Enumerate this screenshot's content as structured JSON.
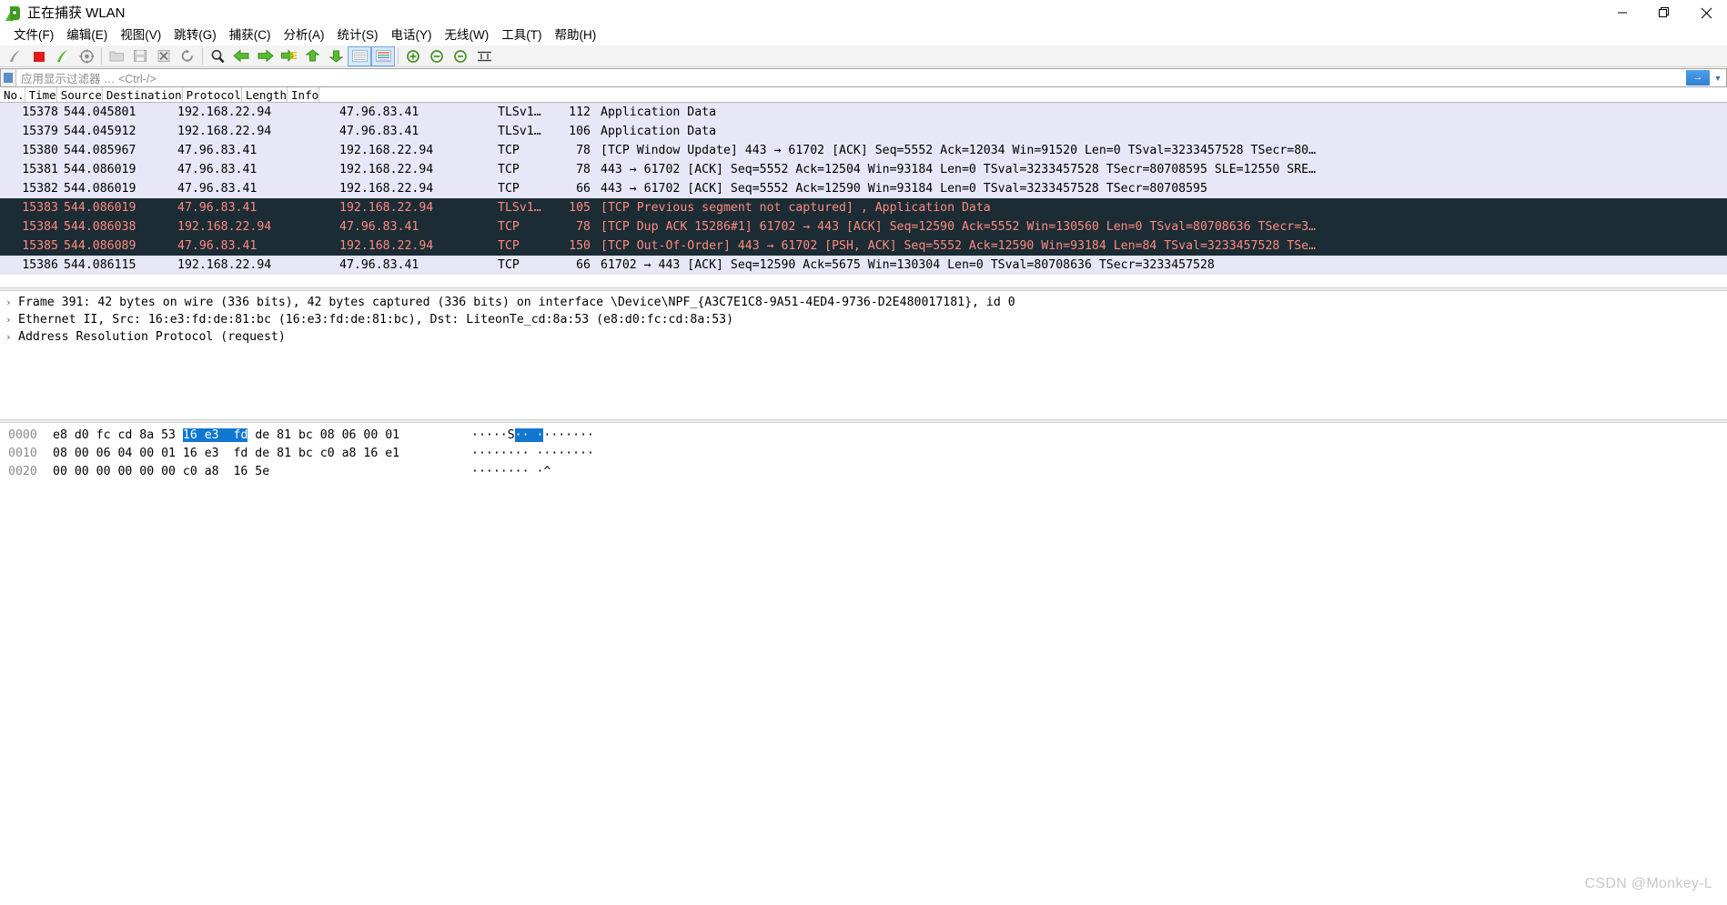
{
  "window": {
    "title": "正在捕获 WLAN",
    "icon": "wireshark-shark-fin-icon",
    "minimize_label": "—",
    "maximize_label": "❐",
    "close_label": "✕"
  },
  "menubar": {
    "items": [
      {
        "label": "文件(F)",
        "name": "menu-file"
      },
      {
        "label": "编辑(E)",
        "name": "menu-edit"
      },
      {
        "label": "视图(V)",
        "name": "menu-view"
      },
      {
        "label": "跳转(G)",
        "name": "menu-go"
      },
      {
        "label": "捕获(C)",
        "name": "menu-capture"
      },
      {
        "label": "分析(A)",
        "name": "menu-analyze"
      },
      {
        "label": "统计(S)",
        "name": "menu-statistics"
      },
      {
        "label": "电话(Y)",
        "name": "menu-telephony"
      },
      {
        "label": "无线(W)",
        "name": "menu-wireless"
      },
      {
        "label": "工具(T)",
        "name": "menu-tools"
      },
      {
        "label": "帮助(H)",
        "name": "menu-help"
      }
    ]
  },
  "toolbar": {
    "buttons": [
      {
        "name": "start-capture-icon",
        "title": "开始捕获"
      },
      {
        "name": "stop-capture-icon",
        "title": "停止捕获"
      },
      {
        "name": "restart-capture-icon",
        "title": "重新开始捕获"
      },
      {
        "name": "capture-options-icon",
        "title": "捕获选项"
      },
      {
        "name": "open-file-icon",
        "title": "打开"
      },
      {
        "name": "save-file-icon",
        "title": "保存"
      },
      {
        "name": "close-file-icon",
        "title": "关闭"
      },
      {
        "name": "reload-file-icon",
        "title": "重新加载"
      },
      {
        "name": "find-packet-icon",
        "title": "查找分组"
      },
      {
        "name": "go-back-icon",
        "title": "后退"
      },
      {
        "name": "go-forward-icon",
        "title": "前进"
      },
      {
        "name": "go-to-packet-icon",
        "title": "转到分组"
      },
      {
        "name": "go-first-packet-icon",
        "title": "第一个分组"
      },
      {
        "name": "go-last-packet-icon",
        "title": "最后一个分组"
      },
      {
        "name": "auto-scroll-icon",
        "title": "自动滚动"
      },
      {
        "name": "colorize-icon",
        "title": "着色"
      },
      {
        "name": "zoom-in-icon",
        "title": "放大"
      },
      {
        "name": "zoom-out-icon",
        "title": "缩小"
      },
      {
        "name": "zoom-reset-icon",
        "title": "正常大小"
      },
      {
        "name": "resize-columns-icon",
        "title": "调整列宽"
      }
    ]
  },
  "filter": {
    "bookmark_icon": "filter-bookmark-icon",
    "value": "",
    "placeholder": "应用显示过滤器 … <Ctrl-/>",
    "apply_label": "→",
    "caret_icon": "chevron-down-icon"
  },
  "packet_list": {
    "columns": [
      {
        "label": "No.",
        "key": "num",
        "class": "num"
      },
      {
        "label": "Time",
        "key": "time",
        "class": "time"
      },
      {
        "label": "Source",
        "key": "src",
        "class": "src"
      },
      {
        "label": "Destination",
        "key": "dst",
        "class": "dst"
      },
      {
        "label": "Protocol",
        "key": "proto",
        "class": "proto"
      },
      {
        "label": "Length",
        "key": "len",
        "class": "len"
      },
      {
        "label": "Info",
        "key": "info",
        "class": "info"
      }
    ],
    "rows": [
      {
        "num": "15378",
        "time": "544.045801",
        "src": "192.168.22.94",
        "dst": "47.96.83.41",
        "proto": "TLSv1…",
        "len": "112",
        "info": "Application Data",
        "style": "normal"
      },
      {
        "num": "15379",
        "time": "544.045912",
        "src": "192.168.22.94",
        "dst": "47.96.83.41",
        "proto": "TLSv1…",
        "len": "106",
        "info": "Application Data",
        "style": "normal"
      },
      {
        "num": "15380",
        "time": "544.085967",
        "src": "47.96.83.41",
        "dst": "192.168.22.94",
        "proto": "TCP",
        "len": "78",
        "info": "[TCP Window Update] 443 → 61702 [ACK] Seq=5552 Ack=12034 Win=91520 Len=0 TSval=3233457528 TSecr=80…",
        "style": "normal"
      },
      {
        "num": "15381",
        "time": "544.086019",
        "src": "47.96.83.41",
        "dst": "192.168.22.94",
        "proto": "TCP",
        "len": "78",
        "info": "443 → 61702 [ACK] Seq=5552 Ack=12504 Win=93184 Len=0 TSval=3233457528 TSecr=80708595 SLE=12550 SRE…",
        "style": "normal"
      },
      {
        "num": "15382",
        "time": "544.086019",
        "src": "47.96.83.41",
        "dst": "192.168.22.94",
        "proto": "TCP",
        "len": "66",
        "info": "443 → 61702 [ACK] Seq=5552 Ack=12590 Win=93184 Len=0 TSval=3233457528 TSecr=80708595",
        "style": "normal"
      },
      {
        "num": "15383",
        "time": "544.086019",
        "src": "47.96.83.41",
        "dst": "192.168.22.94",
        "proto": "TLSv1…",
        "len": "105",
        "info": "[TCP Previous segment not captured] , Application Data",
        "style": "bad"
      },
      {
        "num": "15384",
        "time": "544.086038",
        "src": "192.168.22.94",
        "dst": "47.96.83.41",
        "proto": "TCP",
        "len": "78",
        "info": "[TCP Dup ACK 15286#1] 61702 → 443 [ACK] Seq=12590 Ack=5552 Win=130560 Len=0 TSval=80708636 TSecr=3…",
        "style": "bad"
      },
      {
        "num": "15385",
        "time": "544.086089",
        "src": "47.96.83.41",
        "dst": "192.168.22.94",
        "proto": "TCP",
        "len": "150",
        "info": "[TCP Out-Of-Order] 443 → 61702 [PSH, ACK] Seq=5552 Ack=12590 Win=93184 Len=84 TSval=3233457528 TSe…",
        "style": "bad"
      },
      {
        "num": "15386",
        "time": "544.086115",
        "src": "192.168.22.94",
        "dst": "47.96.83.41",
        "proto": "TCP",
        "len": "66",
        "info": "61702 → 443 [ACK] Seq=12590 Ack=5675 Win=130304 Len=0 TSval=80708636 TSecr=3233457528",
        "style": "normal"
      }
    ]
  },
  "detail_pane": {
    "rows": [
      {
        "twisty": "›",
        "text": "Frame 391: 42 bytes on wire (336 bits), 42 bytes captured (336 bits) on interface \\Device\\NPF_{A3C7E1C8-9A51-4ED4-9736-D2E480017181}, id 0"
      },
      {
        "twisty": "›",
        "text": "Ethernet II, Src: 16:e3:fd:de:81:bc (16:e3:fd:de:81:bc), Dst: LiteonTe_cd:8a:53 (e8:d0:fc:cd:8a:53)"
      },
      {
        "twisty": "›",
        "text": "Address Resolution Protocol (request)"
      }
    ]
  },
  "hex_pane": {
    "rows": [
      {
        "offset": "0000",
        "bytes_pre": "e8 d0 fc cd 8a 53 ",
        "bytes_hl": "16 e3  fd",
        "bytes_post": " de 81 bc 08 06 00 01",
        "ascii_pre": "·····S",
        "ascii_hl": "·· ·",
        "ascii_post": "·······"
      },
      {
        "offset": "0010",
        "bytes_pre": "08 00 06 04 00 01 16 e3  fd de 81 bc c0 a8 16 e1",
        "bytes_hl": "",
        "bytes_post": "",
        "ascii_pre": "········ ········",
        "ascii_hl": "",
        "ascii_post": ""
      },
      {
        "offset": "0020",
        "bytes_pre": "00 00 00 00 00 00 c0 a8  16 5e",
        "bytes_hl": "",
        "bytes_post": "",
        "ascii_pre": "········ ·^",
        "ascii_hl": "",
        "ascii_post": ""
      }
    ]
  },
  "watermark": {
    "text": "CSDN @Monkey-L"
  },
  "colors": {
    "normal_row_bg": "#e7e7f7",
    "bad_row_bg": "#1b2c34",
    "bad_row_fg": "#ff8a80",
    "hex_highlight": "#1177d1",
    "accent": "#53b332"
  }
}
